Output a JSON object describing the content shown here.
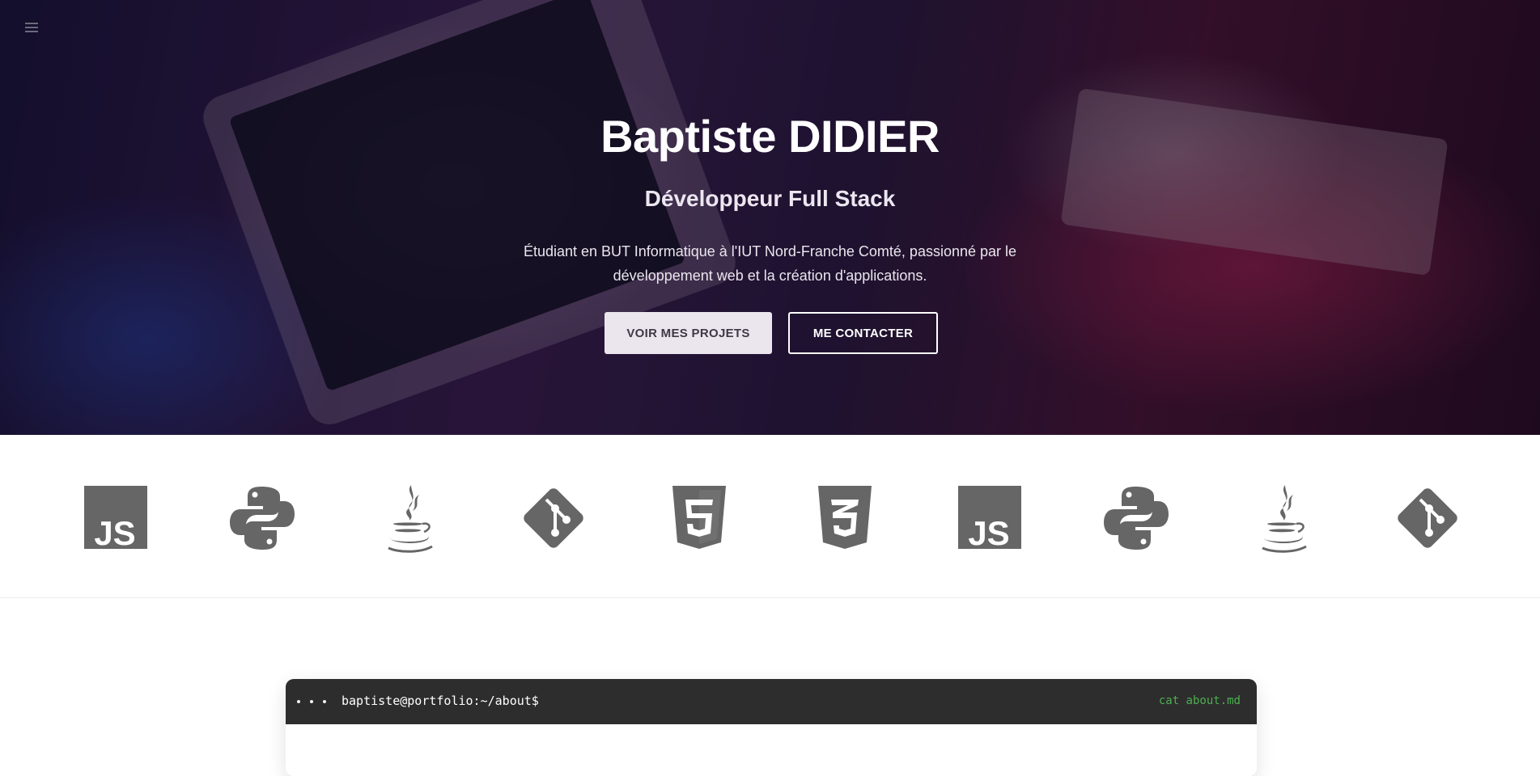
{
  "nav": {
    "menu_icon": "hamburger-menu-icon"
  },
  "hero": {
    "title": "Baptiste DIDIER",
    "subtitle": "Développeur Full Stack",
    "description": "Étudiant en BUT Informatique à l'IUT Nord-Franche Comté, passionné par le développement web et la création d'applications.",
    "buttons": {
      "projects": "VOIR MES PROJETS",
      "contact": "ME CONTACTER"
    }
  },
  "tech_icons": [
    {
      "name": "javascript-icon"
    },
    {
      "name": "python-icon"
    },
    {
      "name": "java-icon"
    },
    {
      "name": "git-icon"
    },
    {
      "name": "html5-icon"
    },
    {
      "name": "css3-icon"
    },
    {
      "name": "javascript-icon"
    },
    {
      "name": "python-icon"
    },
    {
      "name": "java-icon"
    },
    {
      "name": "git-icon"
    }
  ],
  "terminal": {
    "path": "baptiste@portfolio:~/about$",
    "command": "cat about.md"
  },
  "colors": {
    "icon_gray": "#666666",
    "terminal_bg": "#2d2d2d",
    "terminal_cmd": "#4caf50"
  }
}
